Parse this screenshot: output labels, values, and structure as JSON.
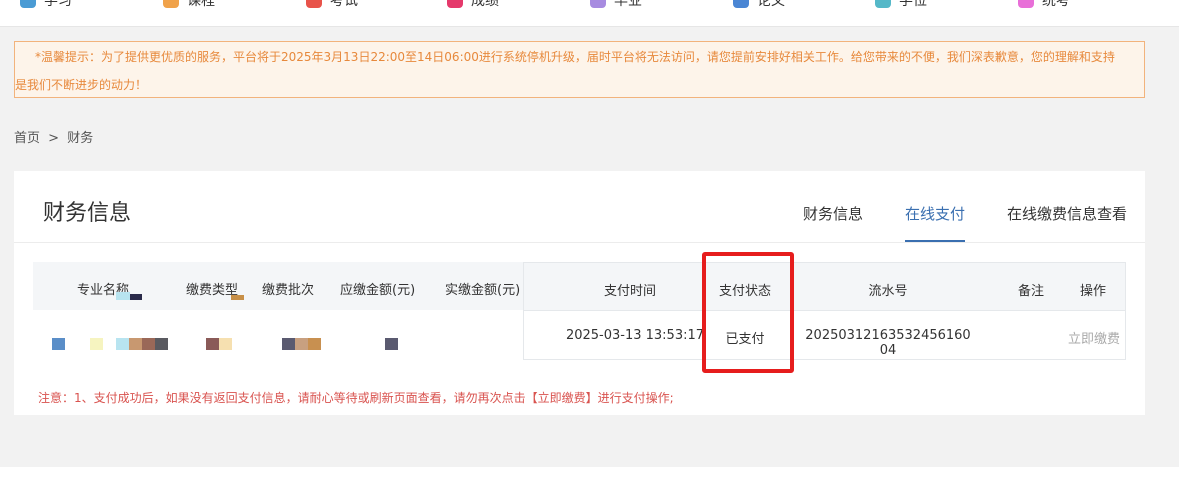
{
  "nav": {
    "items": [
      {
        "label": "学习",
        "color": "#4a9bd4"
      },
      {
        "label": "课程",
        "color": "#f0a24a"
      },
      {
        "label": "考试",
        "color": "#e8534a"
      },
      {
        "label": "成绩",
        "color": "#e5396b"
      },
      {
        "label": "毕业",
        "color": "#a78be0"
      },
      {
        "label": "论文",
        "color": "#4a86d4"
      },
      {
        "label": "学位",
        "color": "#55b8c8"
      },
      {
        "label": "统考",
        "color": "#e86fd8"
      }
    ]
  },
  "notice": {
    "line1": "*温馨提示：为了提供更优质的服务，平台将于2025年3月13日22:00至14日06:00进行系统停机升级，届时平台将无法访问，请您提前安排好相关工作。给您带来的不便，我们深表歉意，您的理解和支持",
    "line2": "是我们不断进步的动力！"
  },
  "breadcrumb": {
    "home": "首页",
    "sep": ">",
    "current": "财务"
  },
  "card": {
    "title": "财务信息",
    "tabs": [
      {
        "label": "财务信息",
        "active": false
      },
      {
        "label": "在线支付",
        "active": true
      },
      {
        "label": "在线缴费信息查看",
        "active": false
      }
    ]
  },
  "table": {
    "left_headers": [
      "专业名称",
      "缴费类型",
      "缴费批次",
      "应缴金额(元)",
      "实缴金额(元)"
    ],
    "headers": {
      "pay_time": "支付时间",
      "status": "支付状态",
      "serial": "流水号",
      "remark": "备注",
      "action": "操作"
    },
    "rows": [
      {
        "pay_time": "2025-03-13 13:53:17",
        "status": "已支付",
        "serial": "20250312163532456160​04",
        "remark": "",
        "action": "立即缴费"
      }
    ]
  },
  "note": "注意：1、支付成功后，如果没有返回支付信息，请耐心等待或刷新页面查看，请勿再次点击【立即缴费】进行支付操作;",
  "colors": {
    "accent": "#3a6fb0",
    "notice_text": "#e7893c",
    "highlight": "#e61d1d"
  }
}
